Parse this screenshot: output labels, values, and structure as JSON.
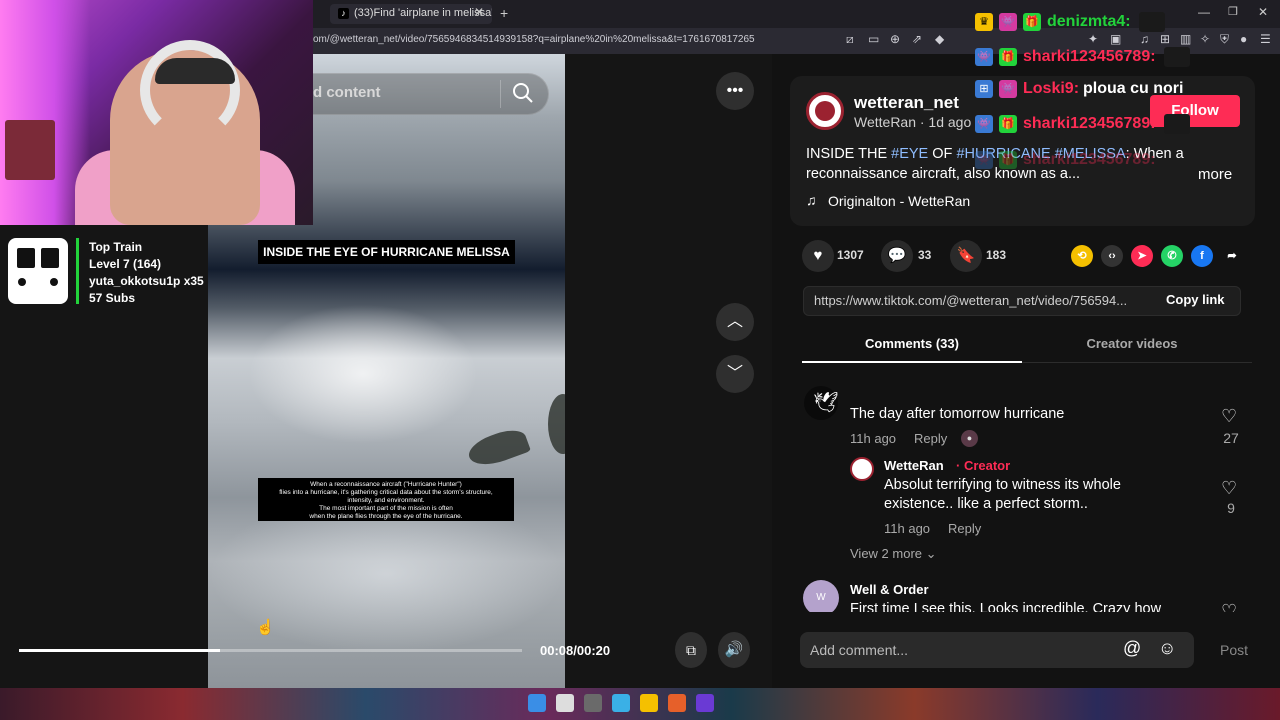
{
  "browser": {
    "tab_title": "(33)Find 'airplane in melissa'",
    "tab_favicon": "tiktok-icon",
    "url": "om/@wetteran_net/video/7565946834514939158?q=airplane%20in%20melissa&t=1761670817265"
  },
  "video": {
    "search_placeholder": "d content",
    "title_overlay": "INSIDE THE EYE OF HURRICANE MELISSA",
    "caption_lines": [
      "When a reconnaissance aircraft (\"Hurricane Hunter\")",
      "flies into a hurricane, it's gathering critical data about the storm's structure,",
      "intensity, and environment.",
      "The most important part of the mission is often",
      "when the plane flies through the eye of the hurricane."
    ],
    "time": "00:08/00:20",
    "progress_fraction": 0.4
  },
  "stream_overlay": {
    "train_title": "Top Train",
    "train_level": "Level 7  (164)",
    "train_user": "yuta_okkotsu1p x35",
    "train_subs": "57 Subs"
  },
  "post": {
    "handle": "wetteran_net",
    "meta": "WetteRan · 1d ago",
    "follow": "Follow",
    "desc_start": "INSIDE THE ",
    "tag_eye": "#EYE",
    "desc_of": " OF ",
    "tag_hurricane": "#HURRICANE",
    "tag_melissa": " #MELISSA",
    "desc_rest": ": When a",
    "desc_line2": "reconnaissance aircraft, also known as a...",
    "more": "more",
    "music": "Originalton - WetteRan",
    "likes": "1307",
    "comments": "33",
    "saves": "183",
    "link": "https://www.tiktok.com/@wetteran_net/video/756594...",
    "copy_link": "Copy link"
  },
  "tabs": {
    "comments": "Comments (33)",
    "creator_videos": "Creator videos"
  },
  "comments": [
    {
      "text": "The day after tomorrow hurricane",
      "time": "11h ago",
      "reply": "Reply",
      "likes": "27"
    },
    {
      "name": "WetteRan",
      "badge": " · Creator",
      "line1": "Absolut terrifying to witness its whole",
      "line2": "existence.. like a perfect storm..",
      "time": "11h ago",
      "reply": "Reply",
      "likes": "9"
    },
    {
      "name": "Well & Order",
      "text": "First time I see this. Looks incredible. Crazy how"
    }
  ],
  "view_more": "View 2 more ⌄",
  "add_comment": "Add comment...",
  "post_btn": "Post",
  "chat": [
    {
      "name": "denizmta4:",
      "msg": "",
      "color": "#22d33b"
    },
    {
      "name": "sharki123456789:",
      "msg": "",
      "color": "#fe2c55"
    },
    {
      "name": "Loski9:",
      "msg": "ploua cu nori",
      "color": "#fe2c55"
    },
    {
      "name": "sharki123456789:",
      "msg": "",
      "color": "#fe2c55"
    },
    {
      "name": "sharki123456789:",
      "msg": "",
      "color": "#fe2c55"
    }
  ],
  "colors": {
    "accent": "#fe2c55",
    "hashtag": "#8fbdff",
    "train_bar": "#22d33b"
  }
}
